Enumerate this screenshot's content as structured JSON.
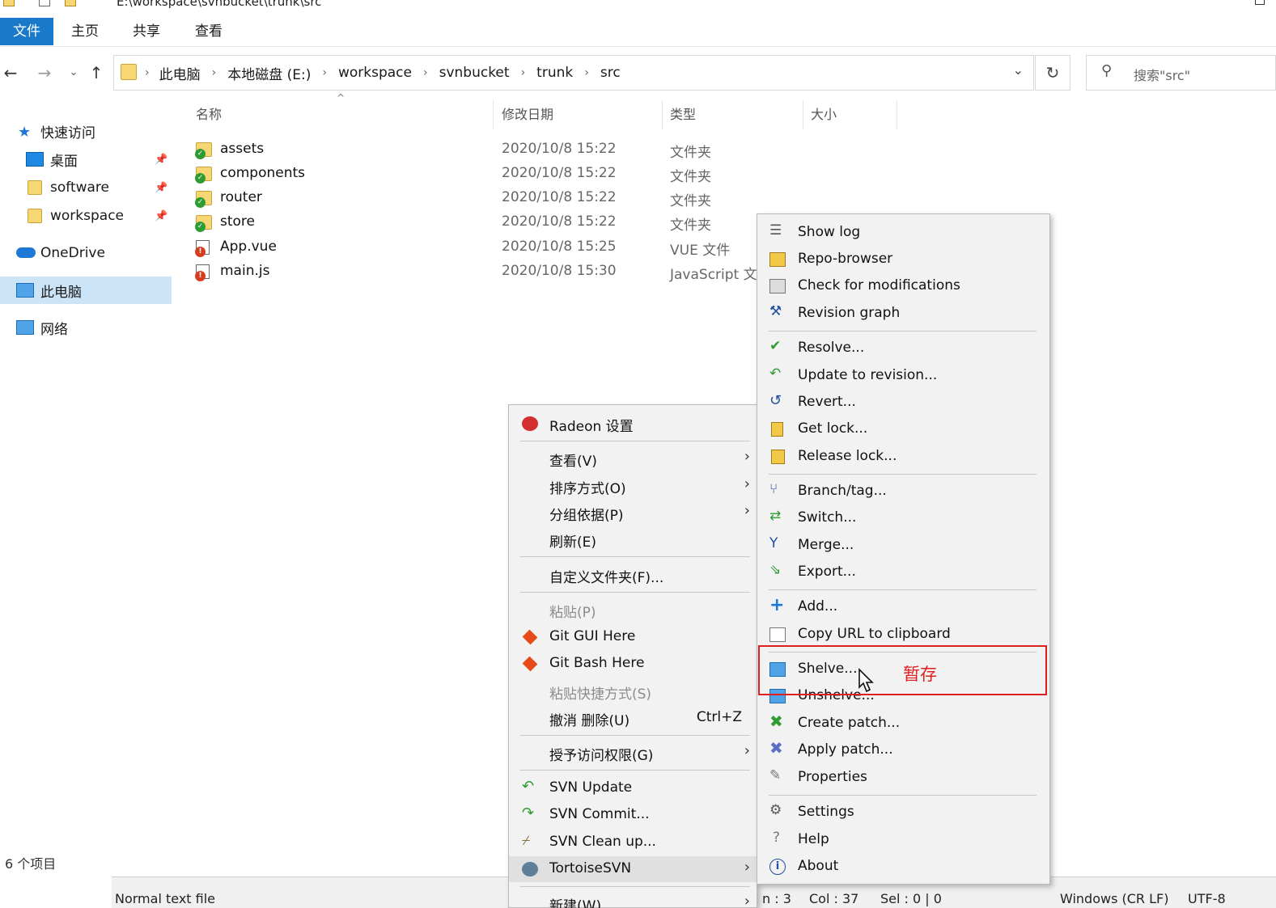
{
  "window": {
    "path": "E:\\workspace\\svnbucket\\trunk\\src"
  },
  "ribbon": {
    "tabs": [
      "文件",
      "主页",
      "共享",
      "查看"
    ]
  },
  "address": {
    "crumbs": [
      "此电脑",
      "本地磁盘 (E:)",
      "workspace",
      "svnbucket",
      "trunk",
      "src"
    ],
    "search_placeholder": "搜索\"src\""
  },
  "nav": {
    "quick_access": "快速访问",
    "desktop": "桌面",
    "software": "software",
    "workspace": "workspace",
    "onedrive": "OneDrive",
    "this_pc": "此电脑",
    "network": "网络"
  },
  "columns": {
    "name": "名称",
    "date": "修改日期",
    "type": "类型",
    "size": "大小"
  },
  "files": [
    {
      "name": "assets",
      "date": "2020/10/8 15:22",
      "type": "文件夹"
    },
    {
      "name": "components",
      "date": "2020/10/8 15:22",
      "type": "文件夹"
    },
    {
      "name": "router",
      "date": "2020/10/8 15:22",
      "type": "文件夹"
    },
    {
      "name": "store",
      "date": "2020/10/8 15:22",
      "type": "文件夹"
    },
    {
      "name": "App.vue",
      "date": "2020/10/8 15:25",
      "type": "VUE 文件"
    },
    {
      "name": "main.js",
      "date": "2020/10/8 15:30",
      "type": "JavaScript 文"
    }
  ],
  "status": {
    "count": "6 个项目"
  },
  "editor_status": {
    "filetype": "Normal text file",
    "ln": "n : 3",
    "col": "Col : 37",
    "sel": "Sel : 0 | 0",
    "eol": "Windows (CR LF)",
    "enc": "UTF-8"
  },
  "context_menu": {
    "radeon": "Radeon 设置",
    "view": "查看(V)",
    "sort": "排序方式(O)",
    "group": "分组依据(P)",
    "refresh": "刷新(E)",
    "customize": "自定义文件夹(F)...",
    "paste": "粘贴(P)",
    "git_gui": "Git GUI Here",
    "git_bash": "Git Bash Here",
    "paste_shortcut": "粘贴快捷方式(S)",
    "undo_delete": "撤消 删除(U)",
    "undo_shortcut": "Ctrl+Z",
    "grant_access": "授予访问权限(G)",
    "svn_update": "SVN Update",
    "svn_commit": "SVN Commit...",
    "svn_cleanup": "SVN Clean up...",
    "tortoise": "TortoiseSVN",
    "new": "新建(W)"
  },
  "svn_menu": {
    "show_log": "Show log",
    "repo_browser": "Repo-browser",
    "check_mod": "Check for modifications",
    "revision_graph": "Revision graph",
    "resolve": "Resolve...",
    "update_rev": "Update to revision...",
    "revert": "Revert...",
    "get_lock": "Get lock...",
    "release_lock": "Release lock...",
    "branch_tag": "Branch/tag...",
    "switch": "Switch...",
    "merge": "Merge...",
    "export": "Export...",
    "add": "Add...",
    "copy_url": "Copy URL to clipboard",
    "shelve": "Shelve...",
    "unshelve": "Unshelve...",
    "create_patch": "Create patch...",
    "apply_patch": "Apply patch...",
    "properties": "Properties",
    "settings": "Settings",
    "help": "Help",
    "about": "About"
  },
  "annotation": {
    "label": "暂存",
    "color": "#e01f1f"
  }
}
